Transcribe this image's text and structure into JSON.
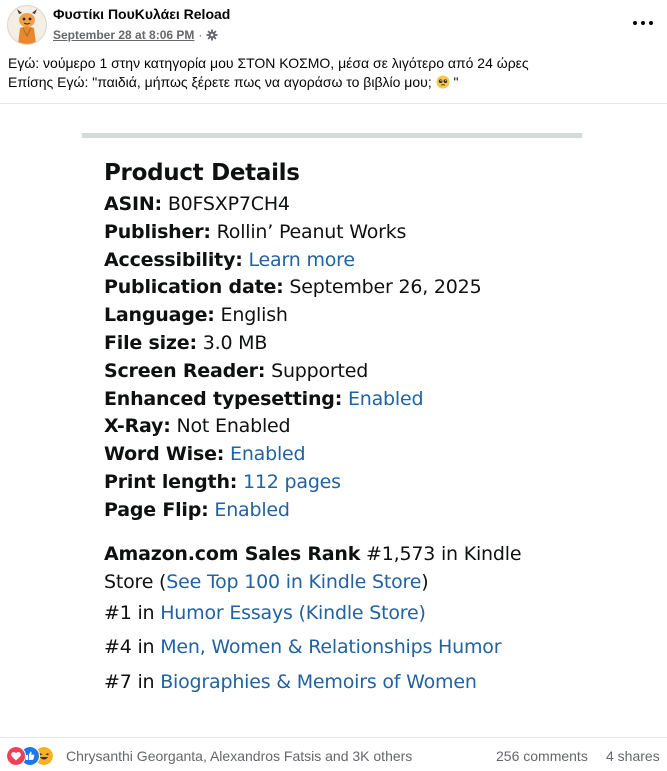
{
  "post": {
    "page_name": "Φυστίκι ΠουΚυλάει Reload",
    "timestamp": "September 28 at 8:06 PM",
    "meta_separator": "·",
    "privacy_icon": "settings-gear-icon",
    "more_icon": "more-options-icon",
    "caption_line1": "Εγώ: νούμερο 1 στην κατηγορία μου ΣΤΟΝ ΚΟΣΜΟ, μέσα σε λιγότερο από 24 ώρες",
    "caption_line2_pre": "Επίσης Εγώ: \"παιδιά, μήπως ξέρετε πως να αγοράσω το βιβλίο μου;",
    "caption_line2_post": "\"",
    "caption_emoji": "pleading-face-emoji"
  },
  "product_details": {
    "title": "Product Details",
    "rows": [
      {
        "label": "ASIN:",
        "value": "B0FSXP7CH4",
        "link": false
      },
      {
        "label": "Publisher:",
        "value": "Rollin’ Peanut Works",
        "link": false
      },
      {
        "label": "Accessibility:",
        "value": "Learn more",
        "link": true
      },
      {
        "label": "Publication date:",
        "value": "September 26, 2025",
        "link": false
      },
      {
        "label": "Language:",
        "value": "English",
        "link": false
      },
      {
        "label": "File size:",
        "value": "3.0 MB",
        "link": false
      },
      {
        "label": "Screen Reader:",
        "value": "Supported",
        "link": false
      },
      {
        "label": "Enhanced typesetting:",
        "value": "Enabled",
        "link": true
      },
      {
        "label": "X-Ray:",
        "value": "Not Enabled",
        "link": false
      },
      {
        "label": "Word Wise:",
        "value": "Enabled",
        "link": true
      },
      {
        "label": "Print length:",
        "value": "112 pages",
        "link": true
      },
      {
        "label": "Page Flip:",
        "value": "Enabled",
        "link": true
      }
    ],
    "sales_rank": {
      "label": "Amazon.com Sales Rank",
      "value": "#1,573 in Kindle",
      "value_line2": "Store (",
      "link": "See Top 100 in Kindle Store",
      "close": ")"
    },
    "category_ranks": [
      {
        "rank": "#1",
        "in": "in",
        "category": "Humor Essays (Kindle Store)"
      },
      {
        "rank": "#4",
        "in": "in",
        "category": "Men, Women & Relationships Humor"
      },
      {
        "rank": "#7",
        "in": "in",
        "category": "Biographies & Memoirs of Women"
      }
    ]
  },
  "footer": {
    "reaction_icons": [
      "love-reaction-icon",
      "like-reaction-icon",
      "haha-reaction-icon"
    ],
    "reactors": "Chrysanthi Georganta, Alexandros Fatsis and 3K others",
    "comments": "256 comments",
    "shares": "4 shares"
  },
  "colors": {
    "link": "#2162a1",
    "meta": "#65676b",
    "like": "#1877f2",
    "love": "#f33e58",
    "haha": "#f7b125"
  }
}
